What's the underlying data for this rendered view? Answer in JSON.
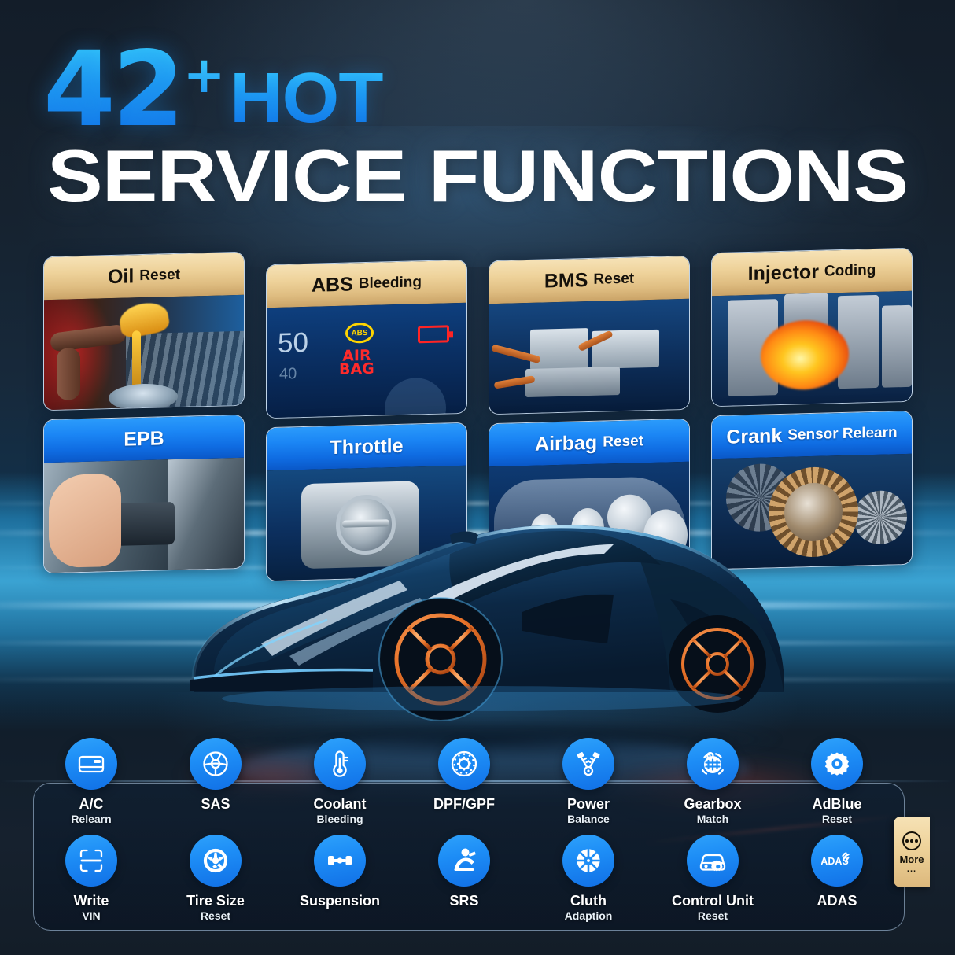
{
  "headline": {
    "count": "42",
    "plus": "+",
    "hot": "HOT",
    "subtitle": "SERVICE FUNCTIONS"
  },
  "colors": {
    "accent_blue": "#1d8df6",
    "accent_cyan": "#35c8fb",
    "gold_band": "#eed29a",
    "header_blue": "#1b86f5",
    "panel_bg": "#101f2f",
    "text_white": "#ffffff"
  },
  "cards": [
    {
      "main": "Oil",
      "sub": "Reset",
      "style": "gold",
      "art": "oil",
      "art_name": "oil-pouring-into-engine-photo"
    },
    {
      "main": "ABS",
      "sub": "Bleeding",
      "style": "gold",
      "art": "abs",
      "art_name": "dashboard-warning-lights-photo"
    },
    {
      "main": "BMS",
      "sub": "Reset",
      "style": "gold",
      "art": "bms",
      "art_name": "battery-management-module-photo"
    },
    {
      "main": "Injector",
      "sub": "Coding",
      "style": "gold",
      "art": "inj",
      "art_name": "fuel-injector-combustion-photo"
    },
    {
      "main": "EPB",
      "sub": "",
      "style": "blue",
      "art": "epb",
      "art_name": "electronic-parking-brake-switch-photo"
    },
    {
      "main": "Throttle",
      "sub": "",
      "style": "blue",
      "art": "thr",
      "art_name": "throttle-body-photo"
    },
    {
      "main": "Airbag",
      "sub": "Reset",
      "style": "blue",
      "art": "air",
      "art_name": "airbag-deployment-diagram-photo"
    },
    {
      "main": "Crank",
      "sub": "Sensor Relearn",
      "style": "blue",
      "art": "crk",
      "art_name": "crankshaft-gears-photo"
    }
  ],
  "hero": {
    "name": "blue-supercar-illustration"
  },
  "icons": [
    {
      "main": "A/C",
      "sub": "Relearn",
      "icon": "ac-panel-icon"
    },
    {
      "main": "SAS",
      "sub": "",
      "icon": "steering-wheel-icon"
    },
    {
      "main": "Coolant",
      "sub": "Bleeding",
      "icon": "thermometer-icon"
    },
    {
      "main": "DPF/GPF",
      "sub": "",
      "icon": "particulate-filter-icon"
    },
    {
      "main": "Power",
      "sub": "Balance",
      "icon": "piston-crankshaft-icon"
    },
    {
      "main": "Gearbox",
      "sub": "Match",
      "icon": "gear-shift-pattern-icon"
    },
    {
      "main": "AdBlue",
      "sub": "Reset",
      "icon": "cog-icon"
    },
    {
      "main": "Write",
      "sub": "VIN",
      "icon": "scan-frame-icon"
    },
    {
      "main": "Tire Size",
      "sub": "Reset",
      "icon": "tire-wheel-icon"
    },
    {
      "main": "Suspension",
      "sub": "",
      "icon": "axle-icon"
    },
    {
      "main": "SRS",
      "sub": "",
      "icon": "seatbelt-occupant-icon"
    },
    {
      "main": "Cluth",
      "sub": "Adaption",
      "icon": "clutch-disc-icon"
    },
    {
      "main": "Control Unit",
      "sub": "Reset",
      "icon": "car-gear-icon"
    },
    {
      "main": "ADAS",
      "sub": "",
      "icon": "adas-signal-icon"
    }
  ],
  "more_tab": {
    "label": "More",
    "ellipsis": "...",
    "icon": "more-dots-icon"
  }
}
